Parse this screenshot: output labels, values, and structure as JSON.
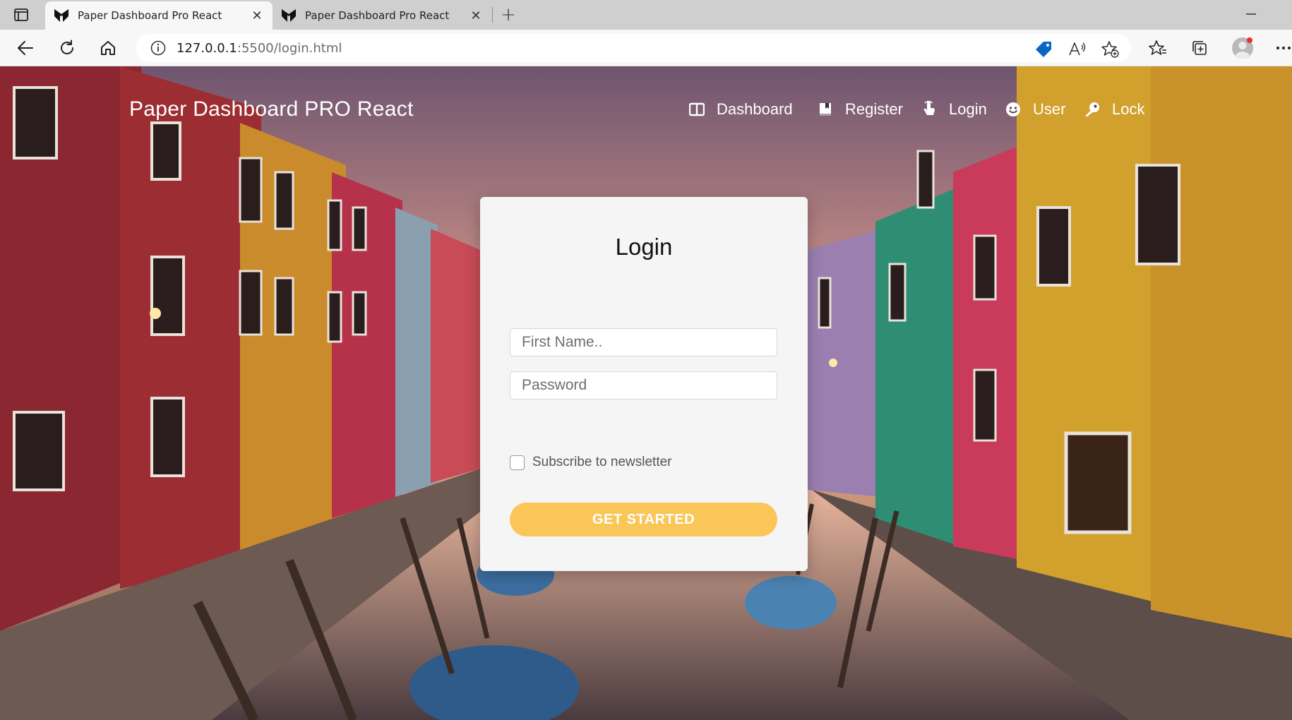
{
  "browser": {
    "tabs": [
      {
        "title": "Paper Dashboard Pro React",
        "active": true
      },
      {
        "title": "Paper Dashboard Pro React",
        "active": false
      }
    ],
    "address": {
      "host": "127.0.0.1",
      "path": ":5500/login.html"
    },
    "icons": {
      "tab_overview": "tab-overview-icon",
      "favicon": "paper-dashboard-favicon",
      "close": "close-icon",
      "new_tab": "plus-icon",
      "minimize": "minimize-icon",
      "back": "back-arrow-icon",
      "reload": "reload-icon",
      "home": "home-icon",
      "info": "info-icon",
      "shopping": "shopping-tag-icon",
      "read_aloud": "read-aloud-icon",
      "add_favorite": "add-favorite-icon",
      "favorites": "favorites-icon",
      "collections": "collections-icon",
      "profile": "profile-avatar-icon",
      "more": "more-icon"
    },
    "accent": "#0a66c2"
  },
  "page": {
    "brand": "Paper Dashboard PRO React",
    "nav": [
      {
        "label": "Dashboard",
        "icon": "layout-icon"
      },
      {
        "label": "Register",
        "icon": "book-bookmark-icon"
      },
      {
        "label": "Login",
        "icon": "tap-pointer-icon"
      },
      {
        "label": "User",
        "icon": "smiley-icon"
      },
      {
        "label": "Lock",
        "icon": "key-icon"
      }
    ]
  },
  "login": {
    "title": "Login",
    "first_name_placeholder": "First Name..",
    "password_placeholder": "Password",
    "subscribe_label": "Subscribe to newsletter",
    "subscribe_checked": false,
    "submit_label": "Get Started",
    "submit_color": "#fbc658"
  }
}
